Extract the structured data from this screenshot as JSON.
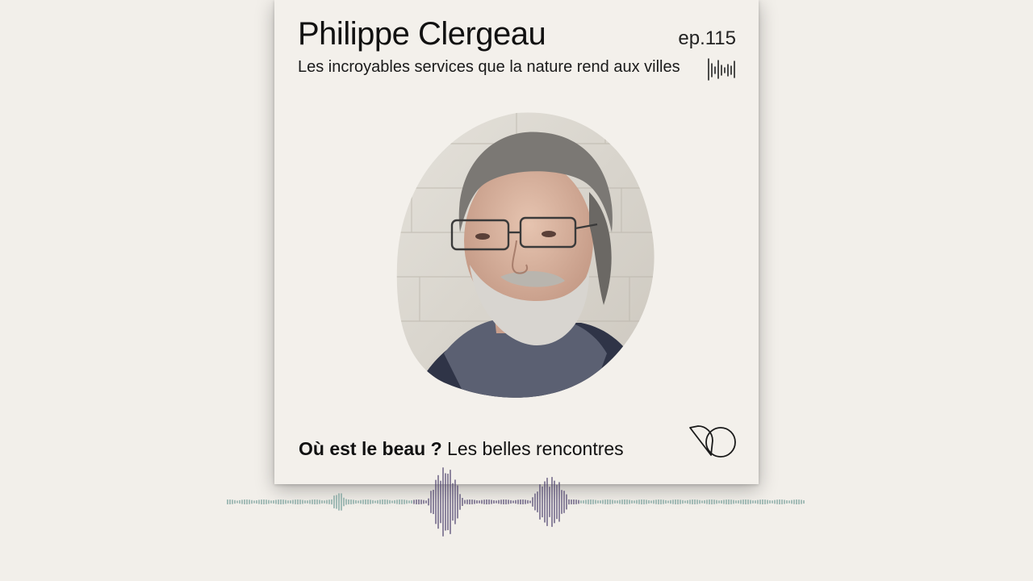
{
  "card": {
    "guest_name": "Philippe Clergeau",
    "episode_number": "ep.115",
    "episode_title": "Les incroyables services que la nature rend aux villes",
    "show_name": "Où est le beau ?",
    "show_tagline": "Les belles rencontres"
  },
  "icons": {
    "top_right": "sound-wave-icon",
    "bottom_right": "show-logo-icon",
    "portrait": "guest-portrait"
  },
  "colors": {
    "background": "#f2efea",
    "card": "#f3f0eb",
    "text": "#111111",
    "wave_teal": "#6f9a95",
    "wave_purple": "#4a3f6b"
  }
}
